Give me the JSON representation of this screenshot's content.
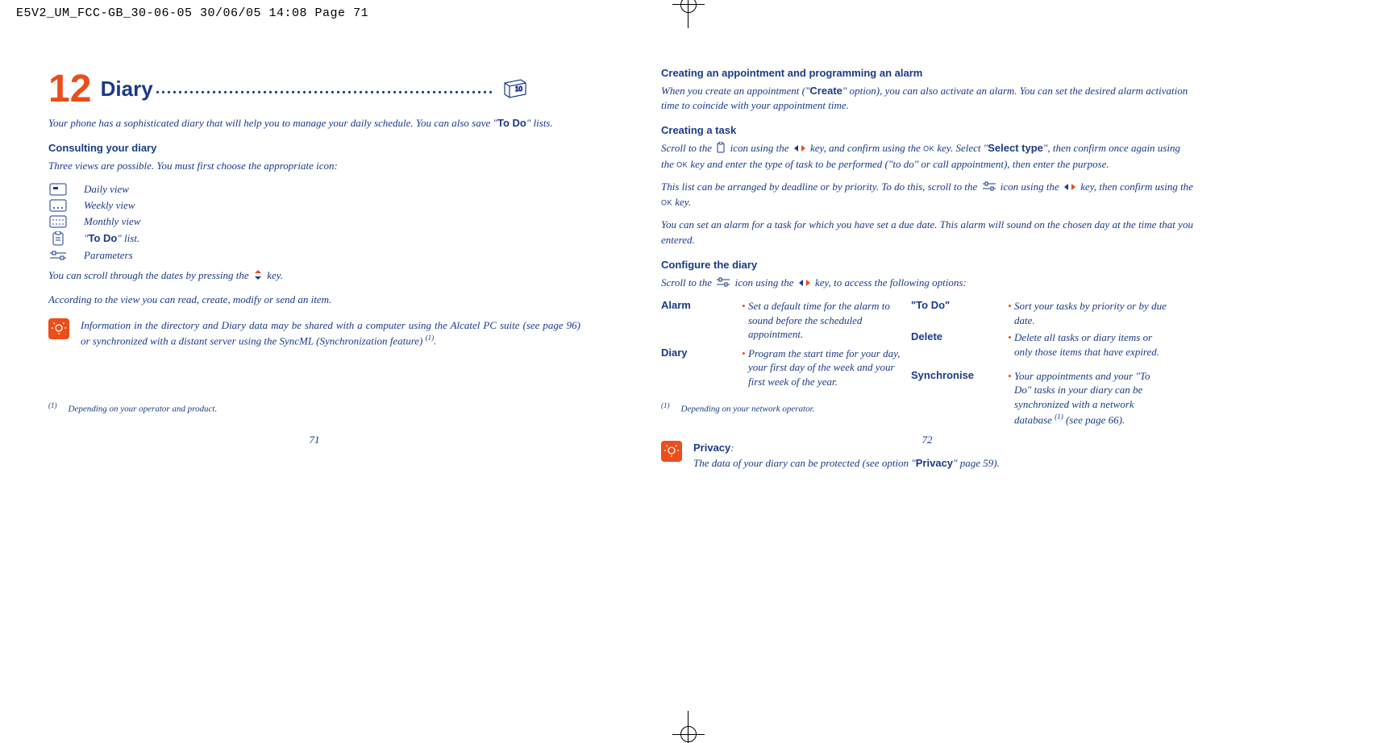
{
  "header": "E5V2_UM_FCC-GB_30-06-05  30/06/05  14:08  Page 71",
  "left": {
    "chapter_num": "12",
    "chapter_title": "Diary",
    "intro_1": "Your phone has a sophisticated diary that will help you to manage your daily schedule. You can also save \"",
    "intro_bold": "To Do",
    "intro_2": "\" lists.",
    "sub1": "Consulting your diary",
    "three_views": "Three views are possible. You must first choose the appropriate icon:",
    "views": [
      {
        "label": "Daily view"
      },
      {
        "label": "Weekly view"
      },
      {
        "label": "Monthly view"
      },
      {
        "label_pre": "\"",
        "label_bold": "To Do",
        "label_post": "\" list."
      },
      {
        "label": "Parameters"
      }
    ],
    "scroll": "You can scroll through the dates by pressing the ",
    "scroll_end": " key.",
    "according": "According to the view you can read, create, modify or send an item.",
    "info": "Information in the directory and Diary data may be shared with a computer using the Alcatel PC suite (see page 96) or synchronized with a distant server using the SyncML (Synchronization feature) ",
    "info_sup": "(1)",
    "info_end": ".",
    "footnote_sup": "(1)",
    "footnote": "Depending on your operator and product.",
    "pagenum": "71"
  },
  "right": {
    "sub1": "Creating an appointment and programming an alarm",
    "p1_a": "When you create an appointment (\"",
    "p1_b": "Create",
    "p1_c": "\" option), you can also activate an alarm. You can set the desired alarm activation time to coincide with your appointment time.",
    "sub2": "Creating a task",
    "p2_a": "Scroll to the ",
    "p2_b": " icon using the ",
    "p2_c": " key, and confirm using the ",
    "p2_d": " key. Select \"",
    "p2_e": "Select type",
    "p2_f": "\", then confirm once again using the ",
    "p2_g": " key and enter the type of task to be performed (\"to do\" or call appointment), then enter the purpose.",
    "p3_a": "This list can be arranged by deadline or by priority. To do this, scroll to the ",
    "p3_b": " icon using the ",
    "p3_c": " key, then confirm using the ",
    "p3_d": " key.",
    "p4": "You can set an alarm for a task for which you have set a due date. This alarm will sound on the chosen day at the time that you entered.",
    "sub3": "Configure the diary",
    "p5_a": "Scroll to the ",
    "p5_b": " icon using the ",
    "p5_c": " key, to access the following options:",
    "cfg": {
      "alarm_label": "Alarm",
      "alarm_desc": "Set a default time for the alarm to sound before the scheduled appointment.",
      "diary_label": "Diary",
      "diary_desc": "Program the start time for your day, your first day of the week and your first week of the year.",
      "todo_label": "\"To Do\"",
      "todo_desc": "Sort your tasks by priority or by due date.",
      "delete_label": "Delete",
      "delete_desc": "Delete all tasks or diary items or only those items that have expired.",
      "sync_label": "Synchronise",
      "sync_desc_a": "Your appointments and your \"To Do\" tasks in your diary can be synchronized with a network database ",
      "sync_sup": "(1)",
      "sync_desc_b": " (see page 66)."
    },
    "privacy_label": "Privacy",
    "privacy_a": "The data of your diary can be protected (see option \"",
    "privacy_b": "Privacy",
    "privacy_c": "\" page 59).",
    "footnote_sup": "(1)",
    "footnote": "Depending on your network operator.",
    "pagenum": "72"
  }
}
